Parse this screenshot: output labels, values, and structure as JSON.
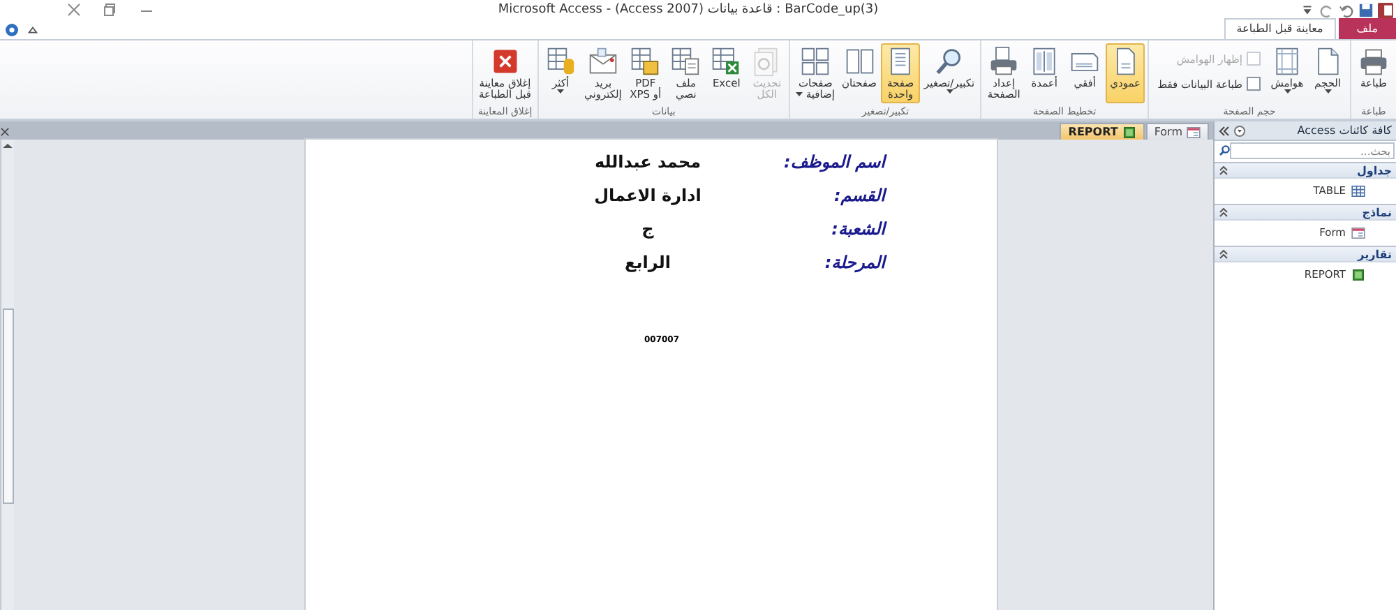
{
  "window": {
    "title": "BarCode_up(3) : قاعدة بيانات (Access 2007) - Microsoft Access"
  },
  "ribbon_tabs": [
    {
      "label": "ملف",
      "kind": "file",
      "selected": false
    },
    {
      "label": "معاينة قبل الطباعة",
      "kind": "tab",
      "selected": true
    }
  ],
  "ribbon_groups": [
    {
      "label": "طباعة",
      "items": [
        {
          "kind": "printer",
          "label": "طباعة",
          "selected": false,
          "disabled": false,
          "dropdown": false
        }
      ]
    },
    {
      "label": "حجم الصفحة",
      "items": [
        {
          "kind": "page-size",
          "label": "الحجم",
          "selected": false,
          "disabled": false,
          "dropdown": true
        },
        {
          "kind": "margins",
          "label": "هوامش",
          "selected": false,
          "disabled": false,
          "dropdown": true
        },
        {
          "kind": "checks",
          "checks": [
            {
              "label": "إظهار الهوامش",
              "checked": false,
              "disabled": true
            },
            {
              "label": "طباعة البيانات فقط",
              "checked": false,
              "disabled": false
            }
          ]
        }
      ]
    },
    {
      "label": "تخطيط الصفحة",
      "items": [
        {
          "kind": "portrait",
          "label": "عمودي",
          "selected": true,
          "disabled": false,
          "dropdown": false
        },
        {
          "kind": "landscape",
          "label": "أفقي",
          "selected": false,
          "disabled": false,
          "dropdown": false
        },
        {
          "kind": "columns",
          "label": "أعمدة",
          "selected": false,
          "disabled": false,
          "dropdown": false
        },
        {
          "kind": "page-setup",
          "label": "إعداد\nالصفحة",
          "selected": false,
          "disabled": false,
          "dropdown": false
        }
      ]
    },
    {
      "label": "تكبير/تصغير",
      "items": [
        {
          "kind": "zoom",
          "label": "تكبير/تصغير",
          "selected": false,
          "disabled": false,
          "dropdown": true
        },
        {
          "kind": "one-page",
          "label": "صفحة\nواحدة",
          "selected": true,
          "disabled": false,
          "dropdown": false
        },
        {
          "kind": "two-pages",
          "label": "صفحتان",
          "selected": false,
          "disabled": false,
          "dropdown": false
        },
        {
          "kind": "more-pages",
          "label": "صفحات\nإضافية",
          "selected": false,
          "disabled": false,
          "dropdown": true
        }
      ]
    },
    {
      "label": "بيانات",
      "items": [
        {
          "kind": "refresh",
          "label": "تحديث\nالكل",
          "selected": false,
          "disabled": true,
          "dropdown": false
        },
        {
          "kind": "excel",
          "label": "Excel",
          "selected": false,
          "disabled": false,
          "dropdown": false
        },
        {
          "kind": "text-file",
          "label": "ملف\nنصي",
          "selected": false,
          "disabled": false,
          "dropdown": false
        },
        {
          "kind": "pdf",
          "label": "PDF\nأو XPS",
          "selected": false,
          "disabled": false,
          "dropdown": false
        },
        {
          "kind": "email",
          "label": "بريد\nإلكتروني",
          "selected": false,
          "disabled": false,
          "dropdown": false
        },
        {
          "kind": "more",
          "label": "أكثر",
          "selected": false,
          "disabled": false,
          "dropdown": true
        }
      ]
    },
    {
      "label": "إغلاق المعاينة",
      "items": [
        {
          "kind": "close",
          "label": "إغلاق معاينة\nقبل الطباعة",
          "selected": false,
          "disabled": false,
          "dropdown": false
        }
      ]
    }
  ],
  "nav_pane": {
    "title": "كافة كائنات Access",
    "search": {
      "placeholder": "بحث..."
    },
    "sections": [
      {
        "label": "جداول",
        "expanded": true,
        "items": [
          {
            "label": "TABLE",
            "kind": "table"
          }
        ]
      },
      {
        "label": "نماذج",
        "expanded": true,
        "items": [
          {
            "label": "Form",
            "kind": "form"
          }
        ]
      },
      {
        "label": "تقارير",
        "expanded": true,
        "items": [
          {
            "label": "REPORT",
            "kind": "report"
          }
        ]
      }
    ]
  },
  "document_tabs": [
    {
      "label": "Form",
      "kind": "form",
      "selected": false
    },
    {
      "label": "REPORT",
      "kind": "report",
      "selected": true
    }
  ],
  "report": {
    "fields": [
      {
        "label": "اسم الموظف:",
        "value": "محمد عبدالله"
      },
      {
        "label": "القسم:",
        "value": "ادارة الاعمال"
      },
      {
        "label": "الشعبة:",
        "value": "ج"
      },
      {
        "label": "المرحلة:",
        "value": "الرابع"
      }
    ],
    "code": "007007"
  }
}
